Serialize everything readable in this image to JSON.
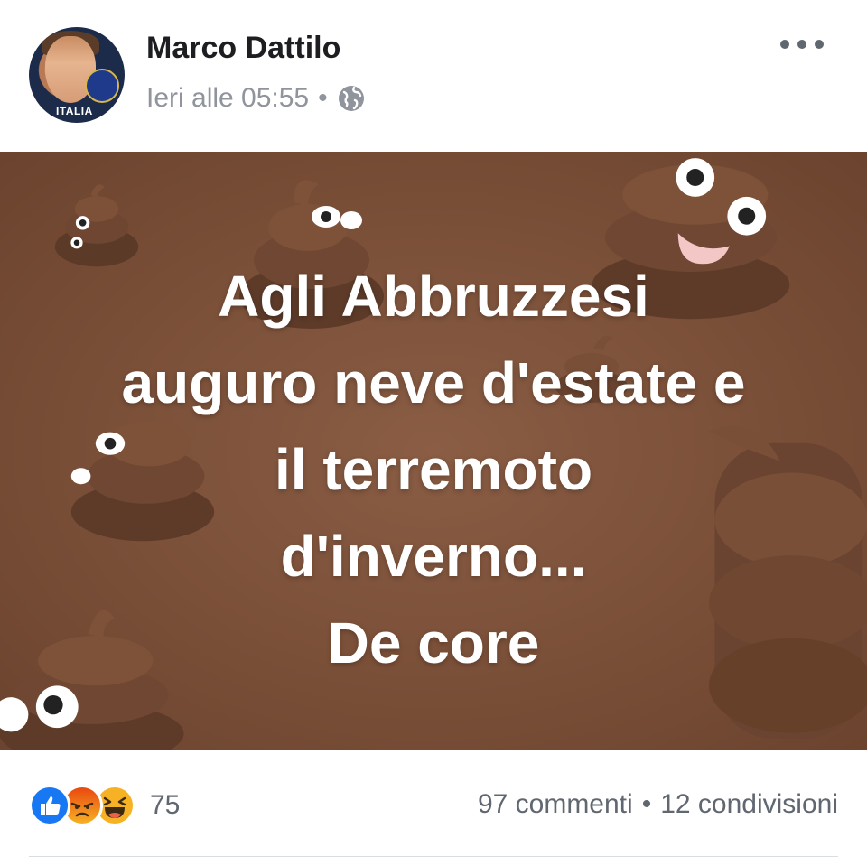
{
  "post": {
    "author": "Marco Dattilo",
    "avatar_text": "ITALIA",
    "timestamp": "Ieri alle 05:55",
    "separator": "•",
    "privacy_icon": "globe-icon",
    "more_icon": "more-options-icon"
  },
  "image": {
    "lines": [
      "Agli Abbruzzesi",
      "auguro neve d'estate e",
      "il terremoto",
      "d'inverno...",
      "De core"
    ],
    "background_color": "#7a4f38",
    "decoration_icon": "poop-emoji-icon"
  },
  "engagement": {
    "reaction_icons": [
      "like-icon",
      "angry-icon",
      "haha-icon"
    ],
    "reaction_count": "75",
    "comments": "97 commenti",
    "separator": "•",
    "shares": "12 condivisioni"
  },
  "colors": {
    "like_blue": "#1877f2",
    "angry_orange": "#e9710f",
    "haha_yellow": "#f7b125",
    "text_secondary": "#606770"
  }
}
